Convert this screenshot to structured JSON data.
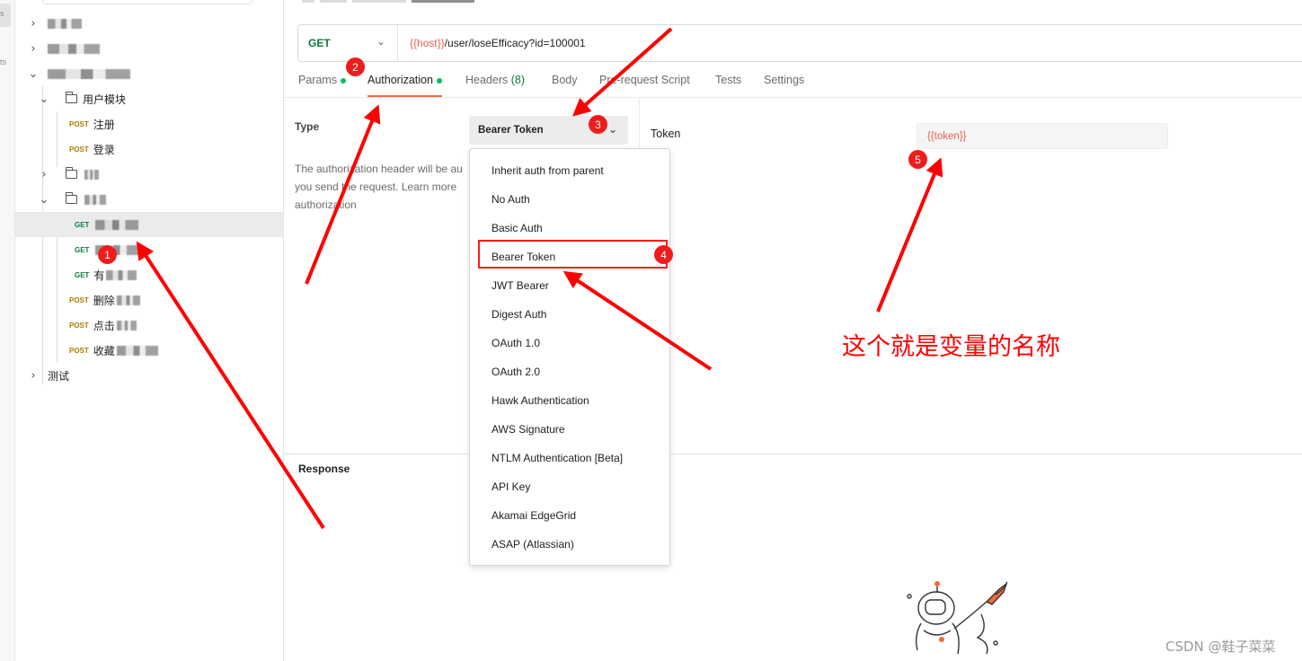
{
  "rail": {
    "fragments": [
      "s",
      "ts"
    ]
  },
  "sidebar": {
    "rows": [
      {
        "kind": "folder-collapsed",
        "label": ""
      },
      {
        "kind": "folder-collapsed",
        "label": ""
      },
      {
        "kind": "folder-expanded",
        "label": ""
      },
      {
        "kind": "subfolder-expanded",
        "label": "用户模块"
      },
      {
        "kind": "request",
        "method": "POST",
        "label": "注册"
      },
      {
        "kind": "request",
        "method": "POST",
        "label": "登录"
      },
      {
        "kind": "subfolder-collapsed",
        "label": ""
      },
      {
        "kind": "subfolder-expanded",
        "label": ""
      },
      {
        "kind": "request",
        "method": "GET",
        "label": "",
        "active": true
      },
      {
        "kind": "request",
        "method": "GET",
        "label": ""
      },
      {
        "kind": "request",
        "method": "GET",
        "label": "有"
      },
      {
        "kind": "request",
        "method": "POST",
        "label": "删除"
      },
      {
        "kind": "request",
        "method": "POST",
        "label": "点击"
      },
      {
        "kind": "request",
        "method": "POST",
        "label": "收藏"
      },
      {
        "kind": "folder-collapsed",
        "label": "测试"
      }
    ]
  },
  "request": {
    "method": "GET",
    "url_var": "{{host}}",
    "url_path": "/user/loseEfficacy?id=100001"
  },
  "tabs": [
    {
      "label": "Params",
      "dot": true,
      "count": ""
    },
    {
      "label": "Authorization",
      "dot": true,
      "count": "",
      "active": true
    },
    {
      "label": "Headers",
      "dot": false,
      "count": "(8)"
    },
    {
      "label": "Body",
      "dot": false,
      "count": ""
    },
    {
      "label": "Pre-request Script",
      "dot": false,
      "count": ""
    },
    {
      "label": "Tests",
      "dot": false,
      "count": ""
    },
    {
      "label": "Settings",
      "dot": false,
      "count": ""
    }
  ],
  "auth": {
    "type_label": "Type",
    "selected_type": "Bearer Token",
    "description_lines": [
      "The authorization header will be au",
      "you send the request. Learn more",
      "authorization"
    ],
    "options": [
      "Inherit auth from parent",
      "No Auth",
      "Basic Auth",
      "Bearer Token",
      "JWT Bearer",
      "Digest Auth",
      "OAuth 1.0",
      "OAuth 2.0",
      "Hawk Authentication",
      "AWS Signature",
      "NTLM Authentication [Beta]",
      "API Key",
      "Akamai EdgeGrid",
      "ASAP (Atlassian)"
    ],
    "token_label": "Token",
    "token_value": "{{token}}"
  },
  "response": {
    "label": "Response"
  },
  "annotations": {
    "badges": [
      "1",
      "2",
      "3",
      "4",
      "5"
    ],
    "note": "这个就是变量的名称",
    "color": "#ff0000"
  },
  "watermark": "CSDN @鞋子菜菜",
  "colors": {
    "get": "#0a7c3c",
    "post": "#b07d00",
    "variable": "#e8614a",
    "tab_underline": "#f26b3a",
    "status_dot": "#0cbb52"
  }
}
